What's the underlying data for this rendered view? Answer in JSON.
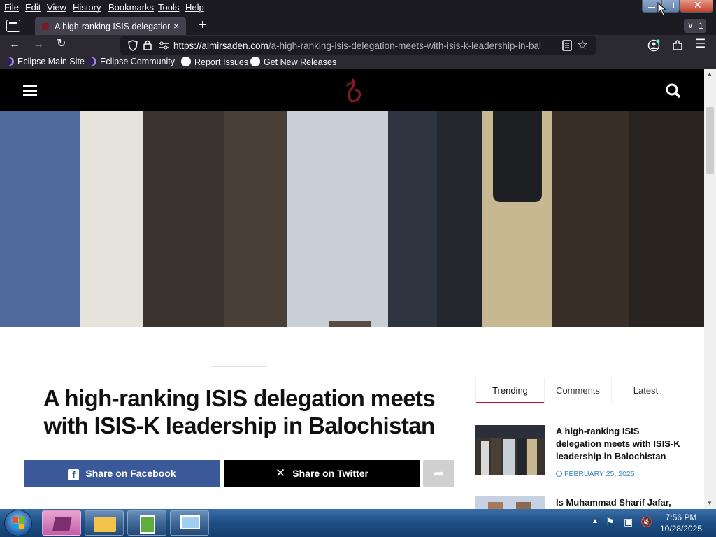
{
  "menu": {
    "items": [
      "File",
      "Edit",
      "View",
      "History",
      "Bookmarks",
      "Tools",
      "Help"
    ]
  },
  "tab": {
    "title": "A high-ranking ISIS delegation r",
    "close": "×",
    "new_tab": "+",
    "overflow_count": "1"
  },
  "urlbar": {
    "domain": "https://almirsaden.com",
    "path": "/a-high-ranking-isis-delegation-meets-with-isis-k-leadership-in-bal"
  },
  "bookmarks": [
    {
      "label": "Eclipse Main Site",
      "icon": "eclipse-icon"
    },
    {
      "label": "Eclipse Community",
      "icon": "eclipse-icon"
    },
    {
      "label": "Report Issues",
      "icon": "github-icon"
    },
    {
      "label": "Get New Releases",
      "icon": "github-icon"
    }
  ],
  "article": {
    "headline": "A high-ranking ISIS delegation meets with ISIS-K leadership in Balochistan",
    "share_facebook": "Share on Facebook",
    "share_twitter": "Share on Twitter"
  },
  "sidebar": {
    "tabs": [
      "Trending",
      "Comments",
      "Latest"
    ],
    "active_tab": "Trending",
    "items": [
      {
        "title": "A high-ranking ISIS delegation meets with ISIS-K leadership in Balochistan",
        "date": "FEBRUARY 25, 2025"
      },
      {
        "title": "Is Muhammad Sharif Jafar,",
        "date": ""
      }
    ]
  },
  "taskbar": {
    "time": "7:56 PM",
    "date": "10/28/2025"
  },
  "colors": {
    "facebook": "#3b5998",
    "twitter": "#000000",
    "accent": "#c8102e",
    "link_blue": "#3a84c4"
  }
}
